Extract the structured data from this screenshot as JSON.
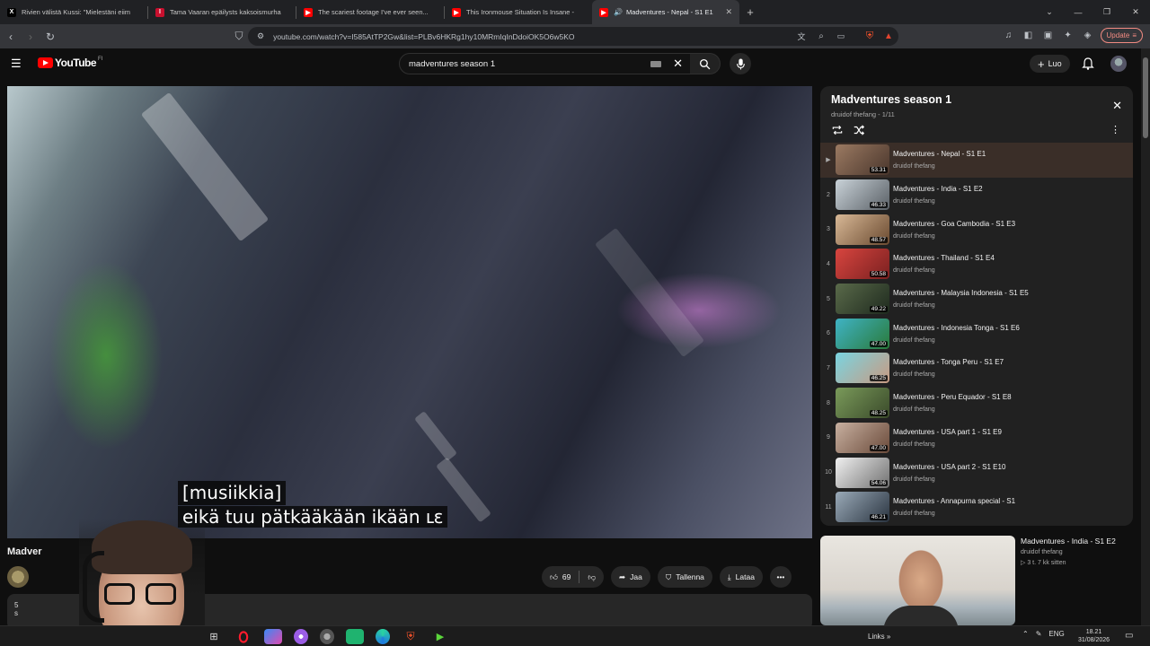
{
  "browser": {
    "tabs": [
      {
        "title": "Rivien välistä Kussi: \"Mielestäni eiim",
        "icon": "x-logo-icon",
        "color": "#000000"
      },
      {
        "title": "Tama Vaaran epäilysts kaksoismurha",
        "icon": "il-logo-icon",
        "color": "#c8102e"
      },
      {
        "title": "The scariest footage I've ever seen...",
        "icon": "youtube-icon",
        "color": "#ff0000"
      },
      {
        "title": "This Ironmouse Situation Is Insane -",
        "icon": "youtube-icon",
        "color": "#ff0000"
      },
      {
        "title": "Madventures - Nepal - S1 E1",
        "icon": "youtube-icon",
        "color": "#ff0000",
        "active": true
      }
    ],
    "url": "youtube.com/watch?v=I585AtTP2Gw&list=PLBv6HKRg1hy10MRmIqInDdoiOK5O6w5KO",
    "update_label": "Update"
  },
  "youtube": {
    "logo_text": "YouTube",
    "region": "FI",
    "search_value": "madventures season 1",
    "create_label": "Luo"
  },
  "player": {
    "subtitle_line1": "[musiikkia]",
    "subtitle_line2": "eikä tuu pätkääkään ikään ւɛ"
  },
  "video": {
    "title_partial": "Madver",
    "likes": "69",
    "share_label": "Jaa",
    "save_label": "Tallenna",
    "download_label": "Lataa",
    "desc_line1": "5",
    "desc_line2": "s"
  },
  "playlist": {
    "title": "Madventures season 1",
    "subtitle": "druidof thefang - 1/11",
    "items": [
      {
        "index": "▶",
        "title": "Madventures - Nepal - S1 E1",
        "channel": "druidof thefang",
        "duration": "53.31",
        "thumb": "#6b4a3a",
        "active": true
      },
      {
        "index": "2",
        "title": "Madventures - India - S1 E2",
        "channel": "druidof thefang",
        "duration": "46.33",
        "thumb": "#8a9aa6"
      },
      {
        "index": "3",
        "title": "Madventures - Goa Cambodia - S1 E3",
        "channel": "druidof thefang",
        "duration": "48.57",
        "thumb": "#b08a6a"
      },
      {
        "index": "4",
        "title": "Madventures - Thailand - S1 E4",
        "channel": "druidof thefang",
        "duration": "50.58",
        "thumb": "#b03a3a"
      },
      {
        "index": "5",
        "title": "Madventures - Malaysia Indonesia - S1 E5",
        "channel": "druidof thefang",
        "duration": "49.22",
        "thumb": "#3a4a3a"
      },
      {
        "index": "6",
        "title": "Madventures - Indonesia Tonga - S1 E6",
        "channel": "druidof thefang",
        "duration": "47.00",
        "thumb": "#2f8a9a"
      },
      {
        "index": "7",
        "title": "Madventures - Tonga Peru - S1 E7",
        "channel": "druidof thefang",
        "duration": "46.25",
        "thumb": "#5ab8c8"
      },
      {
        "index": "8",
        "title": "Madventures - Peru Equador - S1 E8",
        "channel": "druidof thefang",
        "duration": "48.25",
        "thumb": "#4a6a3a"
      },
      {
        "index": "9",
        "title": "Madventures - USA part 1 - S1 E9",
        "channel": "druidof thefang",
        "duration": "47.00",
        "thumb": "#8a7060"
      },
      {
        "index": "10",
        "title": "Madventures - USA part 2 - S1 E10",
        "channel": "druidof thefang",
        "duration": "54.06",
        "thumb": "#c8c8c8"
      },
      {
        "index": "11",
        "title": "Madventures - Annapurna special - S1",
        "channel": "druidof thefang",
        "duration": "46.21",
        "thumb": "#4a5a6a"
      }
    ]
  },
  "next_video": {
    "title": "Madventures - India - S1 E2",
    "channel": "druidof thefang",
    "meta": "▷ 3 t.  7 kk sitten"
  },
  "taskbar": {
    "links_label": "Links",
    "lang": "ENG",
    "time": "18.21",
    "date": "31/08/2026"
  }
}
